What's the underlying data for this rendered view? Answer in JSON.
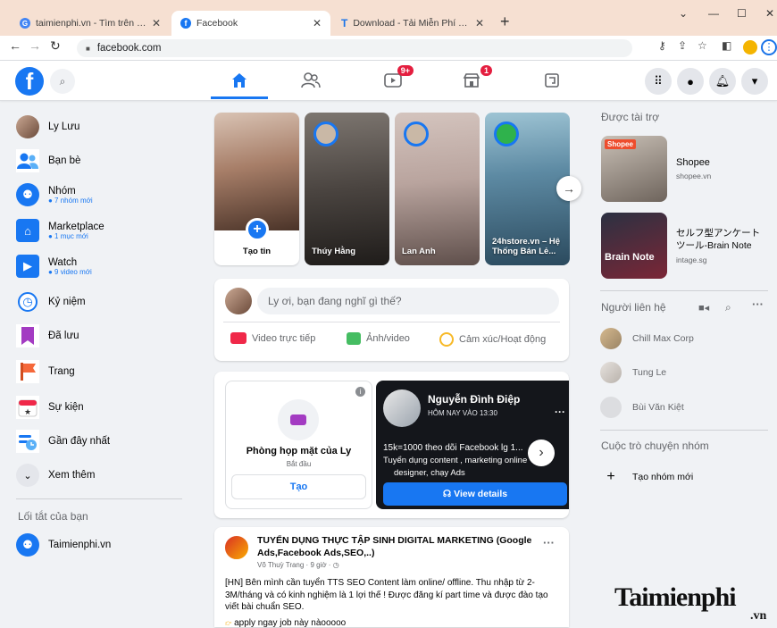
{
  "browser": {
    "tabs": [
      {
        "label": "taimienphi.vn - Tìm trên Google",
        "icon": "google-icon"
      },
      {
        "label": "Facebook",
        "icon": "facebook-icon"
      },
      {
        "label": "Download - Tải Miễn Phí VN - Ph",
        "icon": "taimienphi-icon"
      }
    ],
    "new_tab": "+",
    "url": "facebook.com"
  },
  "header": {
    "logo": "f",
    "nav": [
      {
        "name": "home-icon"
      },
      {
        "name": "friends-icon"
      },
      {
        "name": "watch-icon",
        "badge": "9+"
      },
      {
        "name": "marketplace-icon",
        "badge": "1"
      },
      {
        "name": "gaming-icon"
      }
    ]
  },
  "left_nav": {
    "items": [
      {
        "label": "Ly Lưu",
        "sub": ""
      },
      {
        "label": "Bạn bè",
        "sub": ""
      },
      {
        "label": "Nhóm",
        "sub": "● 7 nhóm mới"
      },
      {
        "label": "Marketplace",
        "sub": "● 1 mục mới"
      },
      {
        "label": "Watch",
        "sub": "● 9 video mới"
      },
      {
        "label": "Kỷ niệm",
        "sub": ""
      },
      {
        "label": "Đã lưu",
        "sub": ""
      },
      {
        "label": "Trang",
        "sub": ""
      },
      {
        "label": "Sự kiện",
        "sub": ""
      },
      {
        "label": "Gần đây nhất",
        "sub": ""
      },
      {
        "label": "Xem thêm",
        "sub": ""
      }
    ],
    "shortcuts_title": "Lối tắt của bạn",
    "shortcuts": [
      {
        "label": "Taimienphi.vn"
      }
    ]
  },
  "stories": {
    "items": [
      {
        "label": "Tạo tin"
      },
      {
        "label": "Thúy Hằng"
      },
      {
        "label": "Lan Anh"
      },
      {
        "label": "24hstore.vn – Hệ Thống Bán Lẻ..."
      }
    ]
  },
  "composer": {
    "placeholder": "Ly ơi, bạn đang nghĩ gì thế?",
    "actions": [
      {
        "label": "Video trực tiếp",
        "color": "#f02849"
      },
      {
        "label": "Ảnh/video",
        "color": "#45bd62"
      },
      {
        "label": "Cảm xúc/Hoạt động",
        "color": "#f7b928"
      }
    ]
  },
  "rooms": {
    "title": "Phòng họp mặt của Ly",
    "subtitle": "Bắt đầu",
    "button": "Tạo",
    "promo": {
      "name": "Nguyễn Đình Điệp",
      "time": "HÔM NAY VÀO 13:30",
      "line1": "15k=1000 theo dõi Facebook lg 1...",
      "line2": "Tuyển dụng content , marketing online",
      "line3": "designer, chạy Ads",
      "button": "View details"
    }
  },
  "post": {
    "title": "TUYỂN DỤNG THỰC TẬP SINH DIGITAL MARKETING (Google Ads,Facebook Ads,SEO,..)",
    "meta": "Võ Thuỳ Trang · 9 giờ · ◷",
    "body": "[HN] Bên mình cần tuyển TTS SEO Content làm online/ offline. Thu nhập từ 2-3M/tháng và có kinh nghiệm là 1 lợi thế ! Được đăng kí part time và được đào tạo viết bài chuẩn SEO.",
    "cta": "apply ngay job này nàooooo",
    "more": "···"
  },
  "sponsored": {
    "title": "Được tài trợ",
    "ads": [
      {
        "name": "Shopee",
        "domain": "shopee.vn",
        "img_text": "Shopee"
      },
      {
        "name": "セルフ型アンケートツール-Brain Note",
        "domain": "intage.sg",
        "img_text": "Brain Note"
      }
    ]
  },
  "contacts": {
    "title": "Người liên hệ",
    "items": [
      {
        "name": "Chill Max Corp"
      },
      {
        "name": "Tung Le"
      },
      {
        "name": "Bùi Văn Kiệt"
      }
    ]
  },
  "groups": {
    "title": "Cuộc trò chuyện nhóm",
    "create": "Tạo nhóm mới"
  },
  "watermark": {
    "text": "Taimienphi",
    "suffix": ".vn"
  }
}
